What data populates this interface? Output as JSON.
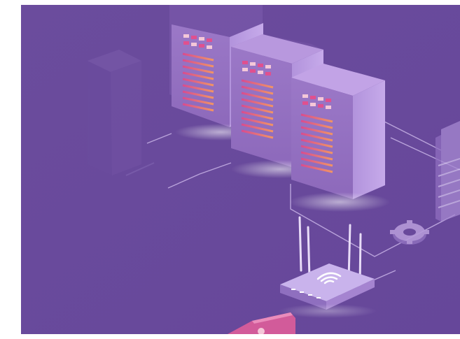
{
  "illustration": {
    "subject": "isometric-server-room",
    "icons": [
      "server-rack-icon",
      "wifi-router-icon",
      "gear-icon",
      "smartphone-lock-icon"
    ],
    "colors": {
      "background": "#6a4a9c",
      "panel_dark": "#7b5aab",
      "panel_light": "#a888cf",
      "accent_pink": "#e0508f",
      "accent_orange": "#f08a5a",
      "accent_light": "#f4c7d8",
      "line": "#c8b3e6"
    }
  }
}
